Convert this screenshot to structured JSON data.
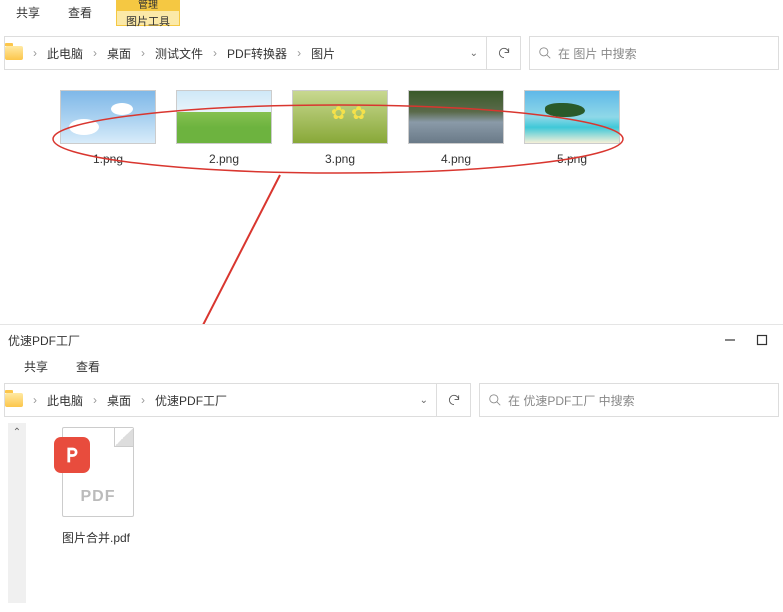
{
  "top_window": {
    "tabs": {
      "share": "共享",
      "view": "查看"
    },
    "ribbon": {
      "manage": "管理",
      "group": "图片工具"
    },
    "breadcrumb": [
      "此电脑",
      "桌面",
      "测试文件",
      "PDF转换器",
      "图片"
    ],
    "search_placeholder": "在 图片 中搜索",
    "thumbnails": [
      {
        "name": "1.png",
        "kind": "sky"
      },
      {
        "name": "2.png",
        "kind": "grass"
      },
      {
        "name": "3.png",
        "kind": "flower"
      },
      {
        "name": "4.png",
        "kind": "river"
      },
      {
        "name": "5.png",
        "kind": "beach"
      }
    ]
  },
  "bottom_window": {
    "title": "优速PDF工厂",
    "tabs": {
      "share": "共享",
      "view": "查看"
    },
    "breadcrumb": [
      "此电脑",
      "桌面",
      "优速PDF工厂"
    ],
    "search_placeholder": "在 优速PDF工厂 中搜索",
    "file": {
      "name": "图片合并.pdf",
      "ext_label": "PDF"
    }
  },
  "annotation": {
    "color": "#d9362f"
  }
}
